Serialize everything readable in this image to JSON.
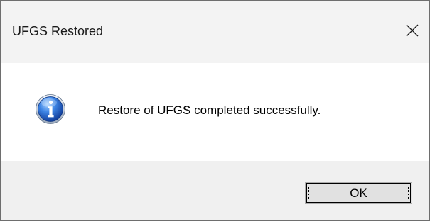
{
  "window": {
    "title": "UFGS Restored",
    "close_icon": "close-icon"
  },
  "body": {
    "icon": "info-icon",
    "message": "Restore of UFGS completed successfully."
  },
  "buttons": {
    "ok_label": "OK"
  },
  "colors": {
    "titlebar_bg": "#f3f3f3",
    "content_bg": "#ffffff",
    "footer_bg": "#f0f0f0",
    "info_icon_blue": "#1f5fc4"
  }
}
